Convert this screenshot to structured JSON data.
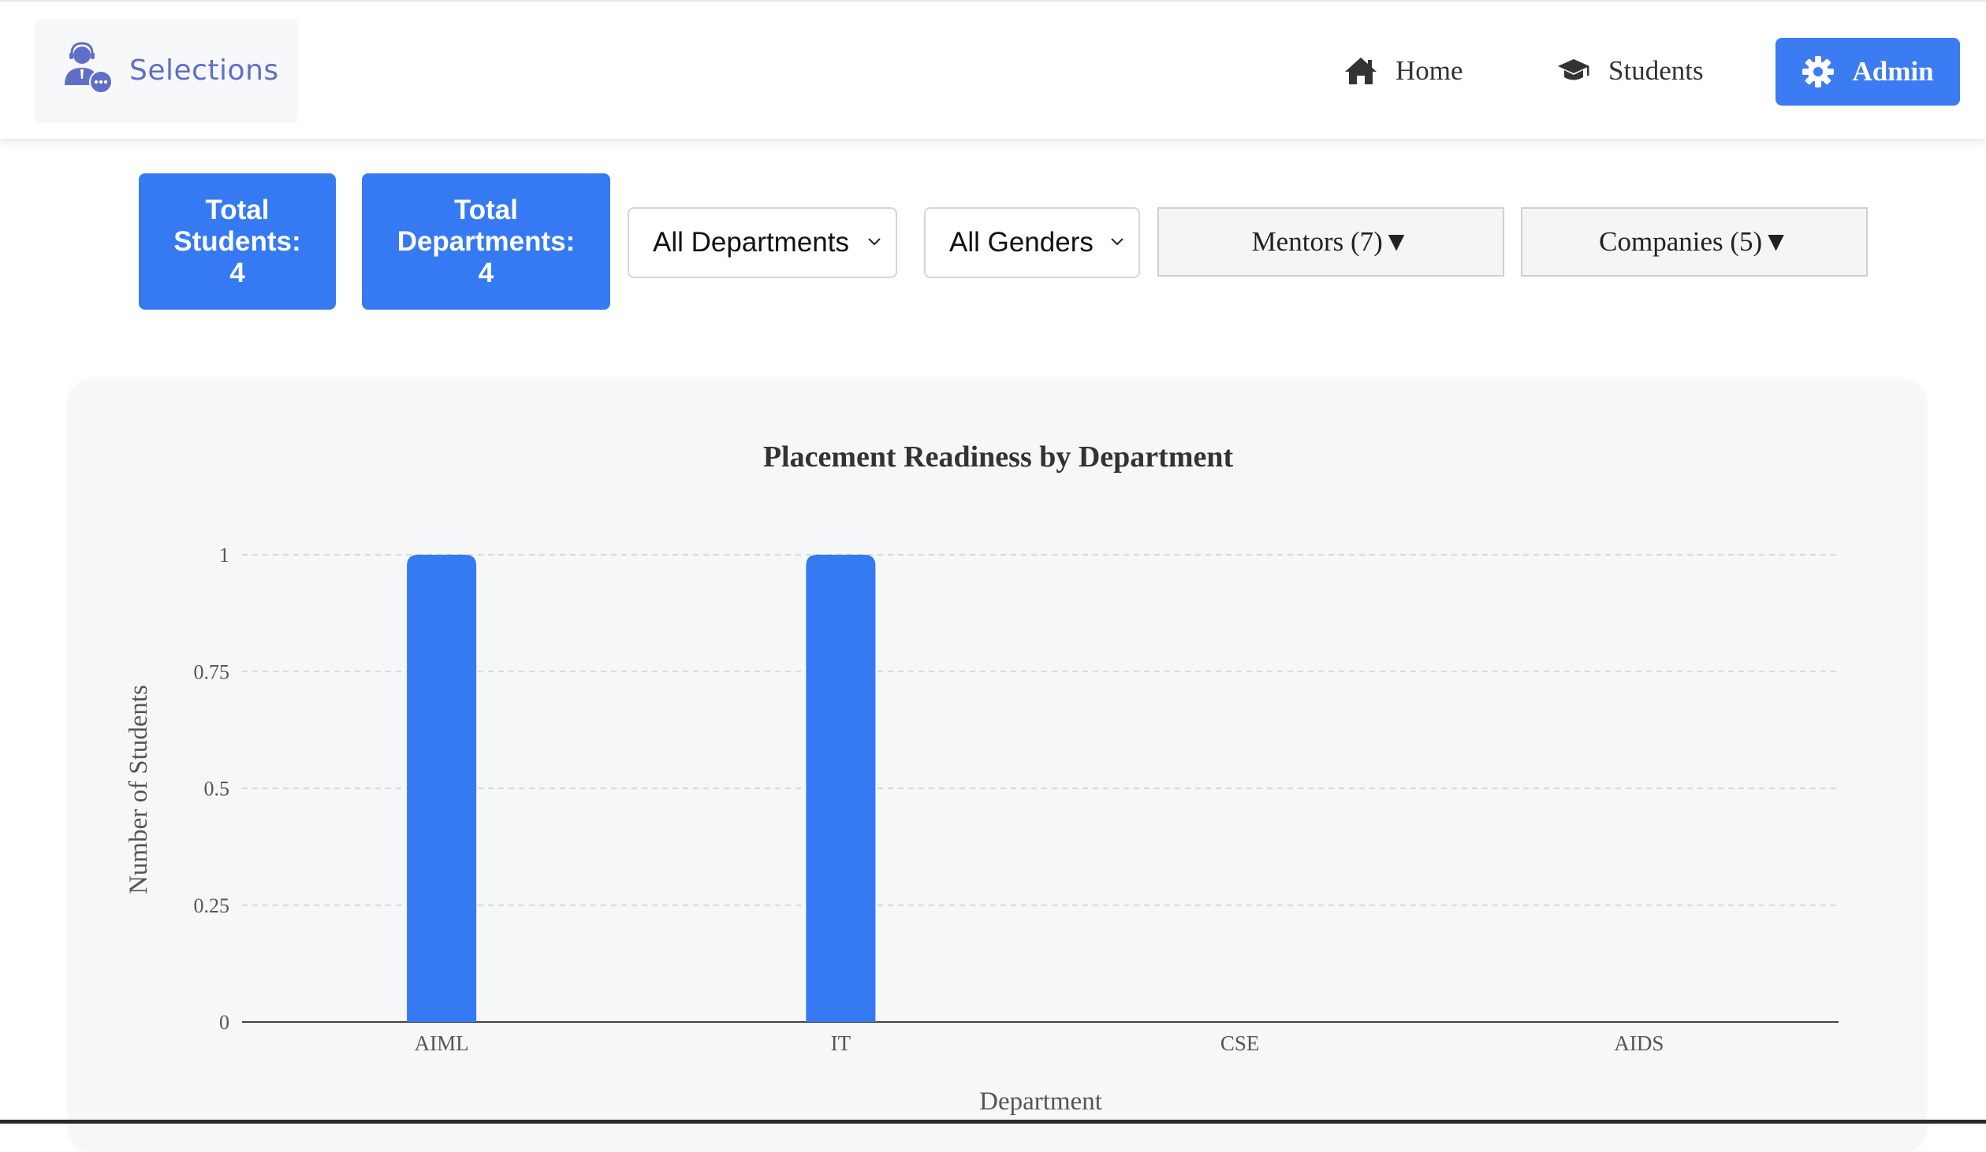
{
  "brand": {
    "name": "Selections",
    "icon": "support-agent-icon"
  },
  "nav": {
    "home": {
      "label": "Home",
      "icon": "home-icon"
    },
    "students": {
      "label": "Students",
      "icon": "graduation-cap-icon"
    },
    "admin": {
      "label": "Admin",
      "icon": "gear-icon",
      "active": true
    }
  },
  "stats": {
    "students": {
      "line1": "Total",
      "line2": "Students:",
      "value": "4"
    },
    "departments": {
      "line1": "Total",
      "line2": "Departments:",
      "value": "4"
    }
  },
  "filters": {
    "department": {
      "selected": "All Departments"
    },
    "gender": {
      "selected": "All Genders"
    }
  },
  "dropdowns": {
    "mentors": "Mentors (7)▼",
    "companies": "Companies (5)▼"
  },
  "colors": {
    "accent": "#357af2",
    "bar": "#3579f3",
    "grid": "#d9d9d9"
  },
  "chart_data": {
    "type": "bar",
    "title": "Placement Readiness by Department",
    "xlabel": "Department",
    "ylabel": "Number of Students",
    "categories": [
      "AIML",
      "IT",
      "CSE",
      "AIDS"
    ],
    "values": [
      1,
      1,
      0,
      0
    ],
    "ylim": [
      0,
      1
    ],
    "yticks": [
      "0",
      "0.25",
      "0.5",
      "0.75",
      "1"
    ],
    "ytick_values": [
      0,
      0.25,
      0.5,
      0.75,
      1
    ],
    "grid": true
  }
}
